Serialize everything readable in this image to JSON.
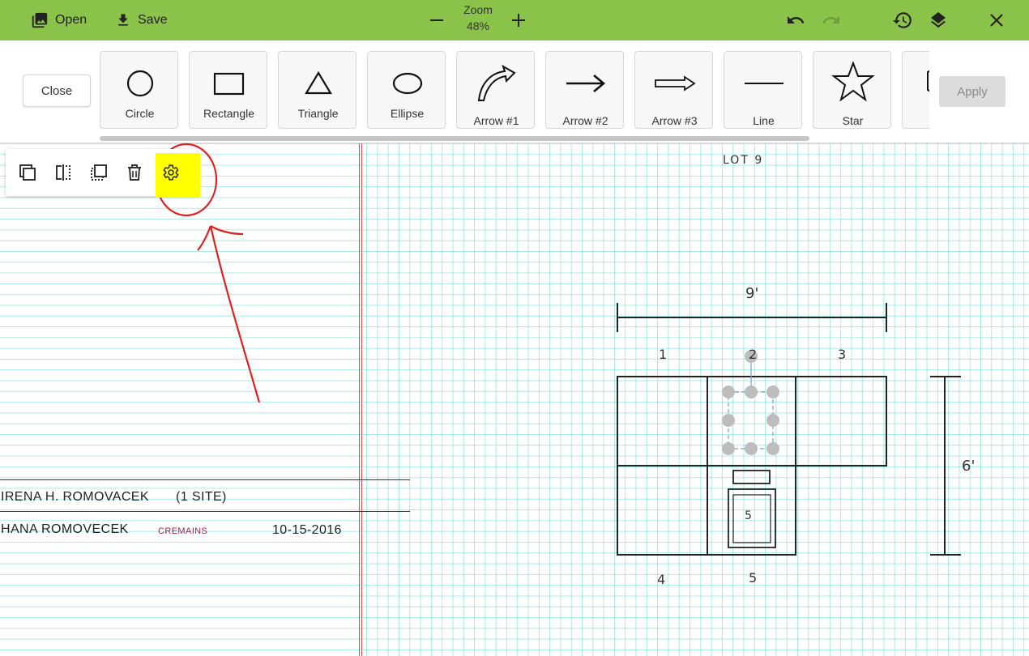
{
  "topbar": {
    "open_label": "Open",
    "save_label": "Save",
    "zoom_label": "Zoom",
    "zoom_value": "48%",
    "accent": "#8bc34a"
  },
  "shapes_bar": {
    "close_label": "Close",
    "apply_label": "Apply",
    "items": [
      {
        "label": "Circle",
        "icon": "circle-icon"
      },
      {
        "label": "Rectangle",
        "icon": "rectangle-icon"
      },
      {
        "label": "Triangle",
        "icon": "triangle-icon"
      },
      {
        "label": "Ellipse",
        "icon": "ellipse-icon"
      },
      {
        "label": "Arrow #1",
        "icon": "curved-arrow-icon"
      },
      {
        "label": "Arrow #2",
        "icon": "arrow-icon"
      },
      {
        "label": "Arrow #3",
        "icon": "hollow-arrow-icon"
      },
      {
        "label": "Line",
        "icon": "line-icon"
      },
      {
        "label": "Star",
        "icon": "star-icon"
      },
      {
        "label": "P",
        "icon": "polygon-icon"
      }
    ]
  },
  "selection_toolbar": {
    "icons": [
      "duplicate-icon",
      "flip-icon",
      "bring-to-front-icon",
      "delete-icon",
      "settings-icon"
    ],
    "highlight_color": "#ffff00",
    "annotation_color": "#e02020"
  },
  "document": {
    "row1_name": "IRENA H. ROMOVACEK",
    "row1_note": "(1 SITE)",
    "row2_name": "HANA ROMOVECEK",
    "row2_tag": "CREMAINS",
    "row2_date": "10-15-2016"
  },
  "drawing": {
    "lot_title": "LOT 9",
    "width_label": "9'",
    "height_label": "6'",
    "plot_numbers_top": [
      "1",
      "2",
      "3"
    ],
    "plot_numbers_bottom": [
      "4",
      "5"
    ],
    "marker_label": "5"
  }
}
